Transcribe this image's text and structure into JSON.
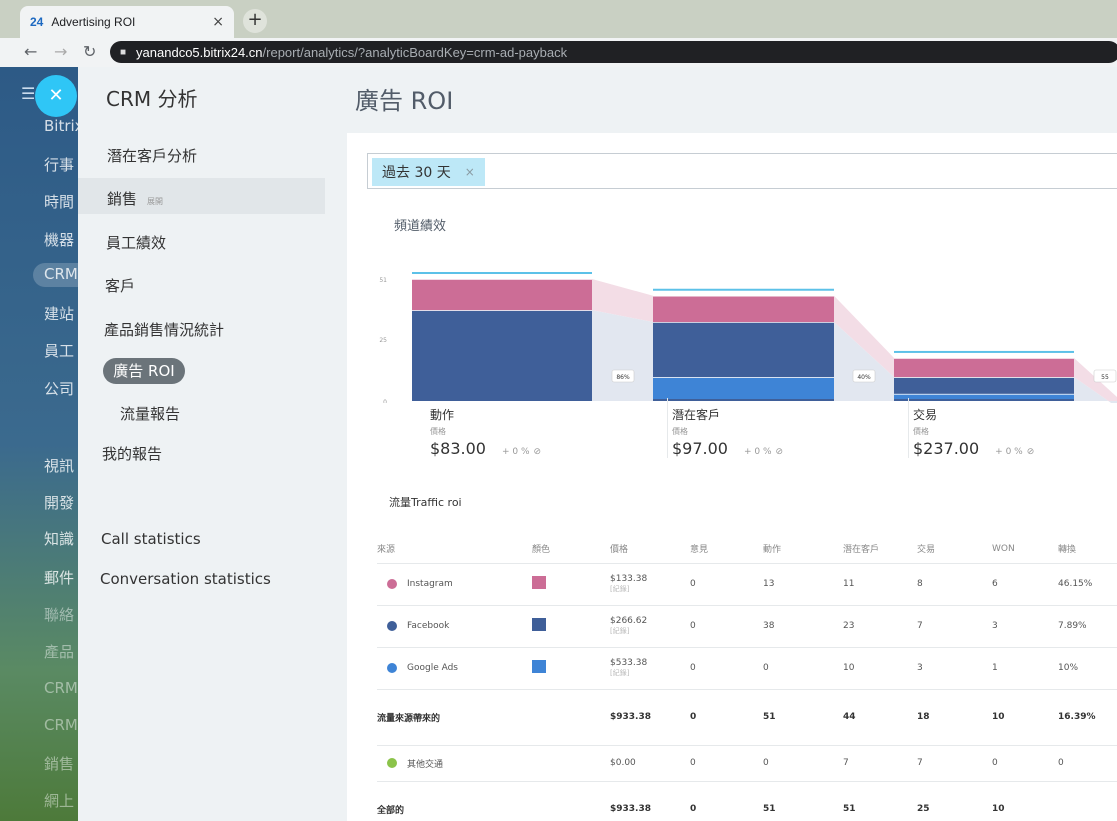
{
  "browser": {
    "tab_favicon": "24",
    "tab_title": "Advertising ROI",
    "tab_close": "×",
    "new_tab": "+",
    "url_host": "yanandco5.bitrix24.cn",
    "url_path": "/report/analytics/?analyticBoardKey=crm-ad-payback"
  },
  "bitrix_sidebar": {
    "items": [
      "Bitrix",
      "行事",
      "時間",
      "機器",
      "CRM",
      "建站",
      "員工",
      "公司",
      "視訊",
      "開發",
      "知識",
      "郵件",
      "聯絡",
      "產品",
      "CRM",
      "CRM",
      "銷售",
      "網上"
    ]
  },
  "crm_menu": {
    "title": "CRM 分析",
    "items": {
      "leads": "潛在客戶分析",
      "sales": "銷售",
      "sales_expand": "展開",
      "staff": "員工績效",
      "customers": "客戶",
      "product_sales": "產品銷售情況統計",
      "ad_roi": "廣告 ROI",
      "traffic_report": "流量報告",
      "my_reports": "我的報告",
      "call_stats": "Call statistics",
      "conv_stats": "Conversation statistics"
    }
  },
  "page": {
    "title": "廣告 ROI",
    "filter_chip": "過去 30 天",
    "filter_chip_remove": "×",
    "funnel_title": "頻道績效",
    "table_title": "流量Traffic roi"
  },
  "chart_data": {
    "type": "bar",
    "stacked": true,
    "yticks": [
      "51",
      "25",
      "0"
    ],
    "ylim": [
      0,
      51
    ],
    "categories": [
      "動作",
      "潛在客戶",
      "交易"
    ],
    "series": [
      {
        "name": "Google Ads",
        "color": "#3e84d6",
        "values": [
          0,
          10,
          3
        ]
      },
      {
        "name": "Facebook",
        "color": "#3f5f99",
        "values": [
          38,
          23,
          7
        ]
      },
      {
        "name": "Instagram",
        "color": "#cc6d96",
        "values": [
          13,
          11,
          8
        ]
      }
    ],
    "conversions": [
      "86%",
      "40%",
      "55"
    ],
    "stages": [
      {
        "name": "動作",
        "price_label": "價格",
        "price": "$83.00",
        "change": "+ 0 %"
      },
      {
        "name": "潛在客戶",
        "price_label": "價格",
        "price": "$97.00",
        "change": "+ 0 %"
      },
      {
        "name": "交易",
        "price_label": "價格",
        "price": "$237.00",
        "change": "+ 0 %"
      }
    ]
  },
  "table": {
    "columns": [
      "來源",
      "顏色",
      "價格",
      "意見",
      "動作",
      "潛在客戶",
      "交易",
      "WON",
      "轉換"
    ],
    "rows": [
      {
        "source": "Instagram",
        "icon": "instagram-icon",
        "icon_color": "#cc6d96",
        "color": "#cc6d96",
        "price": "$133.38",
        "price_sub": "[紀錄]",
        "opinions": "0",
        "actions": "13",
        "leads": "11",
        "deals": "8",
        "won": "6",
        "conversion": "46.15%"
      },
      {
        "source": "Facebook",
        "icon": "facebook-icon",
        "icon_color": "#3f5f99",
        "color": "#3f5f99",
        "price": "$266.62",
        "price_sub": "[紀錄]",
        "opinions": "0",
        "actions": "38",
        "leads": "23",
        "deals": "7",
        "won": "3",
        "conversion": "7.89%"
      },
      {
        "source": "Google Ads",
        "icon": "google-ads-icon",
        "icon_color": "#3e84d6",
        "color": "#3e84d6",
        "price": "$533.38",
        "price_sub": "[紀錄]",
        "opinions": "0",
        "actions": "0",
        "leads": "10",
        "deals": "3",
        "won": "1",
        "conversion": "10%"
      }
    ],
    "traffic_total": {
      "label": "流量來源帶來的",
      "price": "$933.38",
      "opinions": "0",
      "actions": "51",
      "leads": "44",
      "deals": "18",
      "won": "10",
      "conversion": "16.39%"
    },
    "other": {
      "label": "其他交通",
      "icon": "other-traffic-icon",
      "icon_color": "#8bc34a",
      "price": "$0.00",
      "opinions": "0",
      "actions": "0",
      "leads": "7",
      "deals": "7",
      "won": "0",
      "conversion": "0"
    },
    "total": {
      "label": "全部的",
      "price": "$933.38",
      "opinions": "0",
      "actions": "51",
      "leads": "51",
      "deals": "25",
      "won": "10",
      "conversion": ""
    }
  }
}
